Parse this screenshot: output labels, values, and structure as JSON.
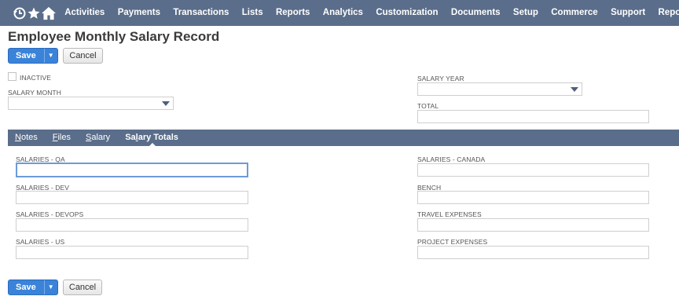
{
  "nav": {
    "items": [
      "Activities",
      "Payments",
      "Transactions",
      "Lists",
      "Reports",
      "Analytics",
      "Customization",
      "Documents",
      "Setup",
      "Commerce",
      "Support",
      "Reports"
    ],
    "icons": [
      "history-icon",
      "star-icon",
      "home-icon"
    ]
  },
  "page": {
    "title": "Employee Monthly Salary Record"
  },
  "buttons": {
    "save": "Save",
    "cancel": "Cancel",
    "dropdown_glyph": "▼"
  },
  "main": {
    "inactive_label": "INACTIVE",
    "salary_month_label": "SALARY MONTH",
    "salary_month_value": "",
    "salary_year_label": "SALARY YEAR",
    "salary_year_value": "",
    "total_label": "TOTAL",
    "total_value": ""
  },
  "subtabs": [
    {
      "first": "N",
      "rest": "otes"
    },
    {
      "first": "F",
      "rest": "iles"
    },
    {
      "first": "S",
      "rest": "alary"
    },
    {
      "pre": "Sa",
      "first": "l",
      "rest": "ary Totals"
    }
  ],
  "fields": {
    "left": [
      {
        "label": "SALARIES - QA",
        "value": ""
      },
      {
        "label": "SALARIES - DEV",
        "value": ""
      },
      {
        "label": "SALARIES - DEVOPS",
        "value": ""
      },
      {
        "label": "SALARIES - US",
        "value": ""
      }
    ],
    "right": [
      {
        "label": "SALARIES - CANADA",
        "value": ""
      },
      {
        "label": "BENCH",
        "value": ""
      },
      {
        "label": "TRAVEL EXPENSES",
        "value": ""
      },
      {
        "label": "PROJECT EXPENSES",
        "value": ""
      }
    ]
  },
  "colors": {
    "nav_bg": "#5a6d8a",
    "save_bg": "#3a83d9",
    "focus_border": "#6c9bd8"
  }
}
